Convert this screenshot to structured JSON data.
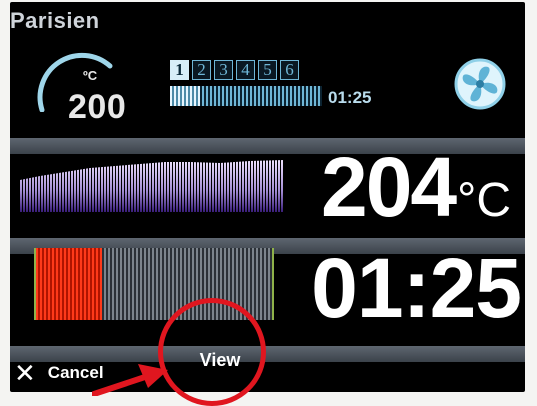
{
  "header": {
    "program_name": "Parisien"
  },
  "setpoint": {
    "unit": "ºC",
    "value": "200"
  },
  "steps": {
    "items": [
      "1",
      "2",
      "3",
      "4",
      "5",
      "6"
    ],
    "active_index": 0,
    "progress_fraction": 0.2,
    "time": "01:25"
  },
  "fan": {
    "icon": "fan-icon"
  },
  "oven": {
    "temperature": "204",
    "unit": "°C"
  },
  "timer": {
    "remaining": "01:25",
    "elapsed_fraction": 0.28
  },
  "actions": {
    "cancel_label": "Cancel",
    "view_label": "View"
  },
  "colors": {
    "screen": "#000000",
    "accent_blue": "#6fb6d6",
    "timer_elapsed": "#ff3a1a",
    "annotation": "#e0161f"
  }
}
